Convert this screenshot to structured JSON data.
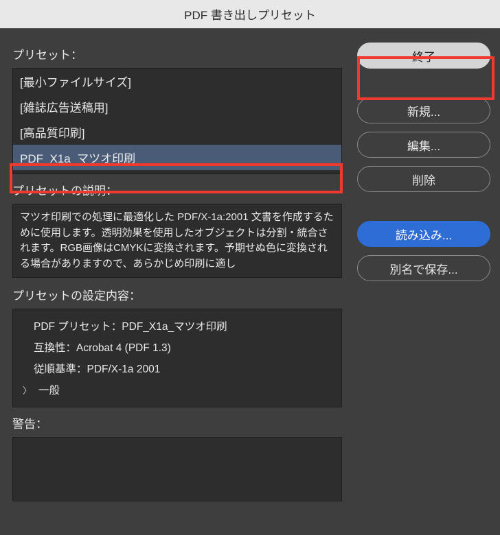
{
  "window": {
    "title": "PDF 書き出しプリセット"
  },
  "labels": {
    "preset": "プリセット：",
    "description": "プリセットの説明：",
    "settings": "プリセットの設定内容：",
    "warning": "警告："
  },
  "presets": {
    "items": [
      {
        "label": "[最小ファイルサイズ]"
      },
      {
        "label": "[雑誌広告送稿用]"
      },
      {
        "label": "[高品質印刷]"
      },
      {
        "label": "PDF_X1a_マツオ印刷"
      }
    ],
    "selectedIndex": 3
  },
  "description": {
    "text": "マツオ印刷での処理に最適化した PDF/X-1a:2001 文書を作成するために使用します。透明効果を使用したオブジェクトは分割・統合されます。RGB画像はCMYKに変換されます。予期せぬ色に変換される場合がありますので、あらかじめ印刷に適し"
  },
  "settings": {
    "preset_line": "PDF プリセット：PDF_X1a_マツオ印刷",
    "compat_line": "互換性：Acrobat 4 (PDF 1.3)",
    "standard_line": "従順基準：PDF/X-1a 2001",
    "general": "一般"
  },
  "buttons": {
    "exit": "終了",
    "new": "新規...",
    "edit": "編集...",
    "delete": "削除",
    "load": "読み込み...",
    "save_as": "別名で保存..."
  }
}
